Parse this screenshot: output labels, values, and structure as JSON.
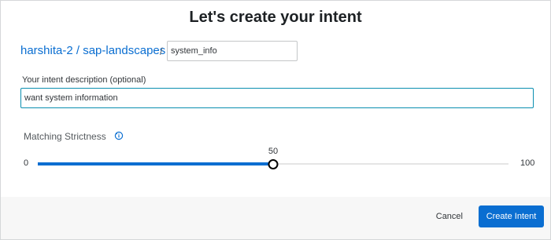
{
  "dialog": {
    "title": "Let's create your intent"
  },
  "breadcrumb": {
    "path": "harshita-2 / sap-landscapes",
    "separator": "/"
  },
  "intent_name": {
    "value": "system_info"
  },
  "description": {
    "label": "Your intent description (optional)",
    "value": "want system information"
  },
  "strictness": {
    "label": "Matching Strictness",
    "icon": "info-icon",
    "min": "0",
    "max": "100",
    "value_label": "50",
    "value": 50
  },
  "footer": {
    "cancel_label": "Cancel",
    "create_label": "Create Intent"
  },
  "colors": {
    "accent": "#0a6ed1",
    "focus_border": "#0a8fb0"
  }
}
